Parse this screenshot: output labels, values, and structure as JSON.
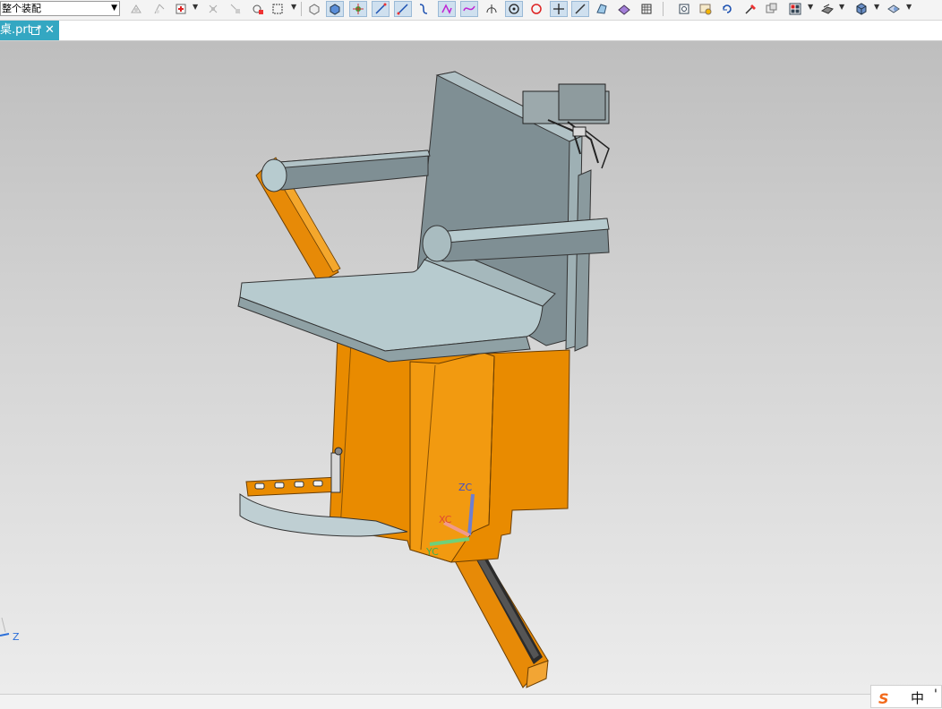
{
  "toolbar": {
    "assembly_filter": "整个装配",
    "icons": [
      "wcs-origin-icon",
      "wcs-dynamic-icon",
      "snap-point-icon",
      "point-constructor-icon",
      "snap-settings-icon",
      "select-body-icon",
      "rectangle-select-icon",
      "view-box-icon",
      "solid-body-icon",
      "feature-icon",
      "line-icon",
      "curve-icon",
      "spline-icon",
      "curve-feature-icon",
      "arc-icon",
      "circle-icon",
      "circle-center-icon",
      "cross-icon",
      "edge-icon",
      "face-icon",
      "sheet-icon",
      "grid-icon",
      "fit-view-icon",
      "zoom-area-icon",
      "rotate-icon",
      "pan-icon",
      "render-style-icon",
      "layout-icon",
      "section-icon",
      "shaded-icon",
      "view-orient-icon"
    ]
  },
  "tabbar": {
    "tab_label": "桌.prt",
    "close_symbol": "✕"
  },
  "viewport": {
    "wcs": {
      "zc": "ZC",
      "xc": "XC",
      "yc": "YC"
    },
    "abs_axis": {
      "z": "Z"
    }
  },
  "ime": {
    "logo": "S",
    "lang": "中",
    "extra": "'"
  },
  "colors": {
    "tab_accent": "#34a7c2",
    "frame_orange": "#e78a07",
    "panel_gray": "#7f8f94",
    "seat_light": "#b7cbcf"
  }
}
